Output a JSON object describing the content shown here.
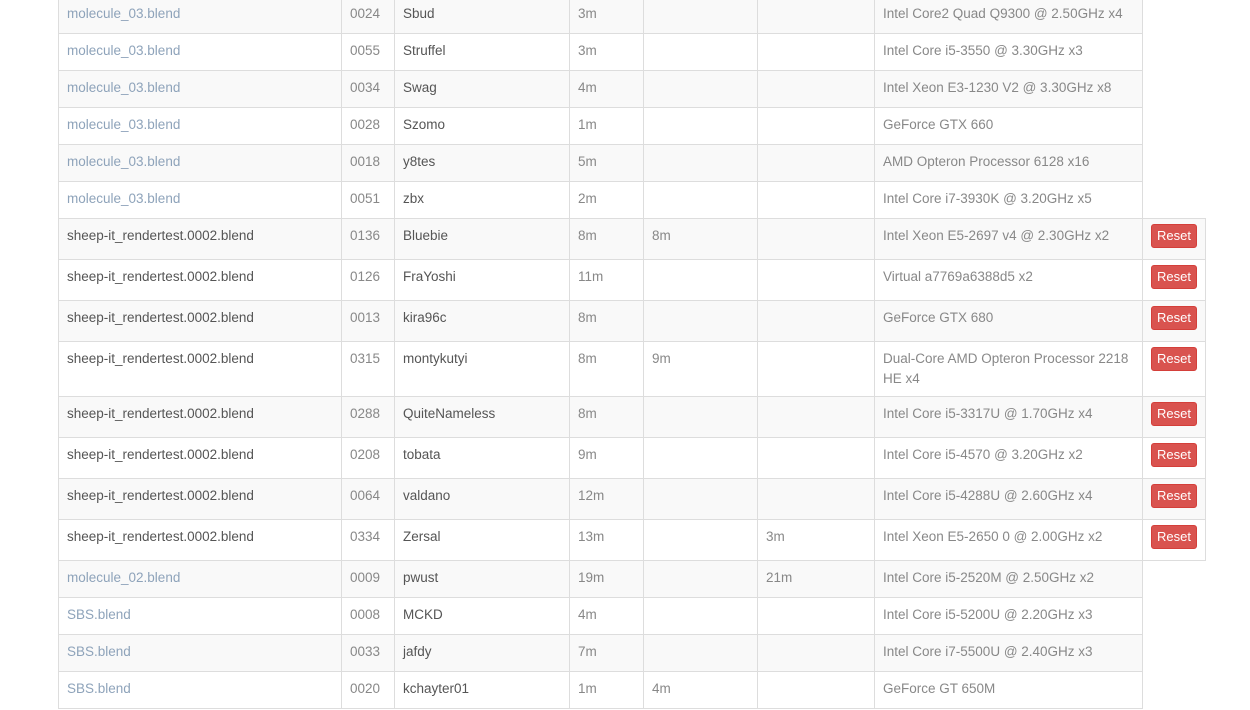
{
  "reset_label": "Reset",
  "rows": [
    {
      "project": "molecule_03.blend",
      "frame": "0024",
      "user": "Sbud",
      "t1": "3m",
      "t2": "",
      "t3": "",
      "cpu": "Intel Core2 Quad Q9300 @ 2.50GHz x4",
      "own": false
    },
    {
      "project": "molecule_03.blend",
      "frame": "0055",
      "user": "Struffel",
      "t1": "3m",
      "t2": "",
      "t3": "",
      "cpu": "Intel Core i5-3550 @ 3.30GHz x3",
      "own": false
    },
    {
      "project": "molecule_03.blend",
      "frame": "0034",
      "user": "Swag",
      "t1": "4m",
      "t2": "",
      "t3": "",
      "cpu": "Intel Xeon E3-1230 V2 @ 3.30GHz x8",
      "own": false
    },
    {
      "project": "molecule_03.blend",
      "frame": "0028",
      "user": "Szomo",
      "t1": "1m",
      "t2": "",
      "t3": "",
      "cpu": "GeForce GTX 660",
      "own": false
    },
    {
      "project": "molecule_03.blend",
      "frame": "0018",
      "user": "y8tes",
      "t1": "5m",
      "t2": "",
      "t3": "",
      "cpu": "AMD Opteron Processor 6128 x16",
      "own": false
    },
    {
      "project": "molecule_03.blend",
      "frame": "0051",
      "user": "zbx",
      "t1": "2m",
      "t2": "",
      "t3": "",
      "cpu": "Intel Core i7-3930K @ 3.20GHz x5",
      "own": false
    },
    {
      "project": "sheep-it_rendertest.0002.blend",
      "frame": "0136",
      "user": "Bluebie",
      "t1": "8m",
      "t2": "8m",
      "t3": "",
      "cpu": "Intel Xeon E5-2697 v4 @ 2.30GHz x2",
      "own": true
    },
    {
      "project": "sheep-it_rendertest.0002.blend",
      "frame": "0126",
      "user": "FraYoshi",
      "t1": "11m",
      "t2": "",
      "t3": "",
      "cpu": "Virtual a7769a6388d5 x2",
      "own": true
    },
    {
      "project": "sheep-it_rendertest.0002.blend",
      "frame": "0013",
      "user": "kira96c",
      "t1": "8m",
      "t2": "",
      "t3": "",
      "cpu": "GeForce GTX 680",
      "own": true
    },
    {
      "project": "sheep-it_rendertest.0002.blend",
      "frame": "0315",
      "user": "montykutyi",
      "t1": "8m",
      "t2": "9m",
      "t3": "",
      "cpu": "Dual-Core AMD Opteron Processor 2218 HE x4",
      "own": true
    },
    {
      "project": "sheep-it_rendertest.0002.blend",
      "frame": "0288",
      "user": "QuiteNameless",
      "t1": "8m",
      "t2": "",
      "t3": "",
      "cpu": "Intel Core i5-3317U @ 1.70GHz x4",
      "own": true
    },
    {
      "project": "sheep-it_rendertest.0002.blend",
      "frame": "0208",
      "user": "tobata",
      "t1": "9m",
      "t2": "",
      "t3": "",
      "cpu": "Intel Core i5-4570 @ 3.20GHz x2",
      "own": true
    },
    {
      "project": "sheep-it_rendertest.0002.blend",
      "frame": "0064",
      "user": "valdano",
      "t1": "12m",
      "t2": "",
      "t3": "",
      "cpu": "Intel Core i5-4288U @ 2.60GHz x4",
      "own": true
    },
    {
      "project": "sheep-it_rendertest.0002.blend",
      "frame": "0334",
      "user": "Zersal",
      "t1": "13m",
      "t2": "",
      "t3": "3m",
      "cpu": "Intel Xeon E5-2650 0 @ 2.00GHz x2",
      "own": true
    },
    {
      "project": "molecule_02.blend",
      "frame": "0009",
      "user": "pwust",
      "t1": "19m",
      "t2": "",
      "t3": "21m",
      "cpu": "Intel Core i5-2520M @ 2.50GHz x2",
      "own": false
    },
    {
      "project": "SBS.blend",
      "frame": "0008",
      "user": "MCKD",
      "t1": "4m",
      "t2": "",
      "t3": "",
      "cpu": "Intel Core i5-5200U @ 2.20GHz x3",
      "own": false
    },
    {
      "project": "SBS.blend",
      "frame": "0033",
      "user": "jafdy",
      "t1": "7m",
      "t2": "",
      "t3": "",
      "cpu": "Intel Core i7-5500U @ 2.40GHz x3",
      "own": false
    },
    {
      "project": "SBS.blend",
      "frame": "0020",
      "user": "kchayter01",
      "t1": "1m",
      "t2": "4m",
      "t3": "",
      "cpu": "GeForce GT 650M",
      "own": false
    }
  ]
}
